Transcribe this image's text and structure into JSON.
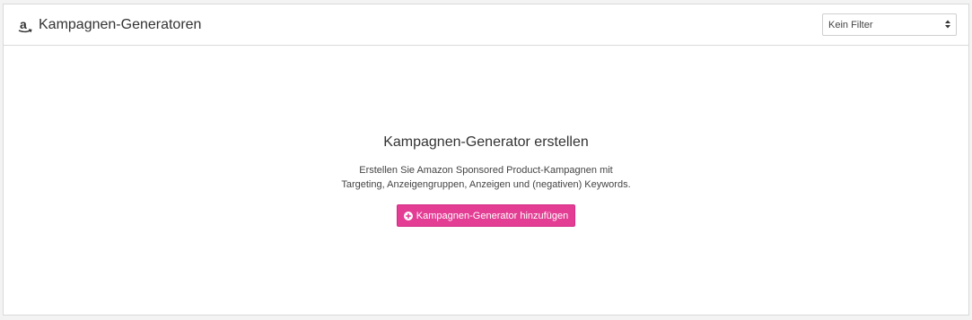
{
  "header": {
    "title": "Kampagnen-Generatoren",
    "icon": "amazon-logo-icon"
  },
  "filter": {
    "selected": "Kein Filter",
    "icon": "select-arrows-icon"
  },
  "empty_state": {
    "title": "Kampagnen-Generator erstellen",
    "description_line1": "Erstellen Sie Amazon Sponsored Product-Kampagnen mit",
    "description_line2": "Targeting, Anzeigengruppen, Anzeigen und (negativen) Keywords.",
    "button_label": "Kampagnen-Generator hinzufügen",
    "button_icon": "plus-circle-icon"
  },
  "colors": {
    "accent": "#e33d94",
    "border": "#d9d9d9",
    "background": "#f3f3f3"
  }
}
